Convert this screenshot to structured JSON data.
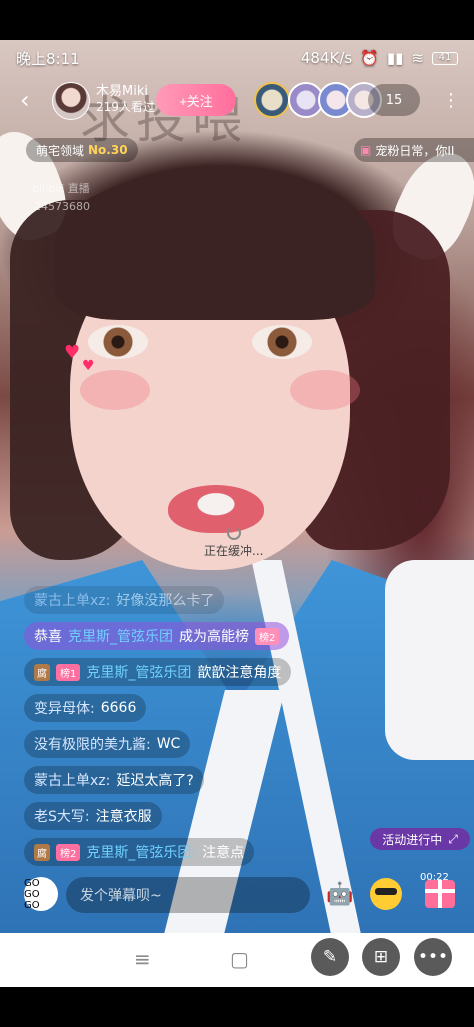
{
  "status_bar": {
    "time": "晚上8:11",
    "speed": "484K/s",
    "battery": "41"
  },
  "header": {
    "host_name": "木易Miki",
    "viewers_text": "219人看过",
    "follow_label": "+关注",
    "online_count": "15"
  },
  "badges": {
    "area_label": "萌宅领域",
    "area_rank": "No.30",
    "fan_chip": "宠粉日常，你II",
    "bili_logo": "bilibili 直播",
    "room_id": "24573680"
  },
  "player": {
    "buffering_text": "正在缓冲..."
  },
  "chat": [
    {
      "name": "蒙古上单xz:",
      "text": "好像没那么卡了"
    },
    {
      "prefix": "恭喜",
      "name": "克里斯_管弦乐团",
      "text": "成为高能榜",
      "badge": "榜2"
    },
    {
      "fan": "腐",
      "badge": "榜1",
      "name": "克里斯_管弦乐团",
      "text": "歆歆注意角度"
    },
    {
      "name": "变异母体:",
      "text": "6666"
    },
    {
      "name": "没有极限的美九酱:",
      "text": "WC"
    },
    {
      "name": "蒙古上单xz:",
      "text": "延迟太高了?"
    },
    {
      "name": "老S大写:",
      "text": "注意衣服"
    },
    {
      "fan": "腐",
      "badge": "榜2",
      "name": "克里斯_管弦乐团:",
      "text": "注意点"
    }
  ],
  "activity": {
    "label": "活动进行中"
  },
  "bottom_bar": {
    "avatar_text": "GO GO GO",
    "input_placeholder": "发个弹幕呗~",
    "gift_count": "00:22"
  },
  "icons": {
    "back": "chevron-left-icon",
    "menu": "more-vert-icon",
    "nav_menu": "menu-icon",
    "nav_home": "square-icon",
    "nav_back": "back-triangle-icon",
    "fab_edit": "pencil-icon",
    "fab_grid": "grid-icon",
    "fab_more": "ellipsis-icon"
  },
  "colors": {
    "follow_button": "#ff6e9c",
    "rank_yellow": "#ffd35a",
    "highlight_blue": "#6fd0ff"
  }
}
